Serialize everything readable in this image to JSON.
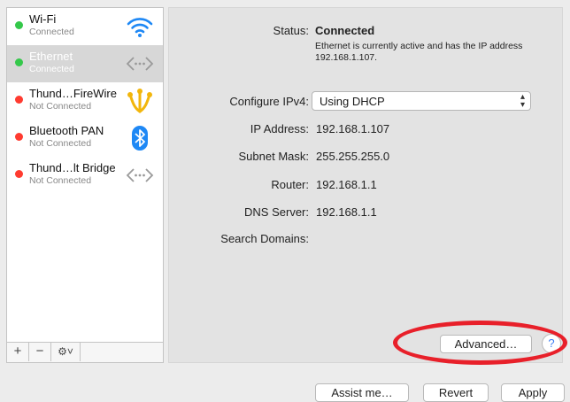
{
  "services": [
    {
      "name": "Wi-Fi",
      "status": "Connected",
      "status_color": "#34c84a",
      "icon": "wifi-icon",
      "selected": false
    },
    {
      "name": "Ethernet",
      "status": "Connected",
      "status_color": "#34c84a",
      "icon": "ethernet-icon",
      "selected": true
    },
    {
      "name": "Thund…FireWire",
      "status": "Not Connected",
      "status_color": "#ff3b30",
      "icon": "firewire-icon",
      "selected": false
    },
    {
      "name": "Bluetooth PAN",
      "status": "Not Connected",
      "status_color": "#ff3b30",
      "icon": "bluetooth-icon",
      "selected": false
    },
    {
      "name": "Thund…lt Bridge",
      "status": "Not Connected",
      "status_color": "#ff3b30",
      "icon": "ethernet-icon",
      "selected": false
    }
  ],
  "sidebar_controls": {
    "add": "+",
    "remove": "−",
    "gear": "⚙˅"
  },
  "details": {
    "status_label": "Status:",
    "status_value": "Connected",
    "status_note": "Ethernet is currently active and has the IP address 192.168.1.107.",
    "configure_label": "Configure IPv4:",
    "configure_value": "Using DHCP",
    "ip_label": "IP Address:",
    "ip_value": "192.168.1.107",
    "mask_label": "Subnet Mask:",
    "mask_value": "255.255.255.0",
    "router_label": "Router:",
    "router_value": "192.168.1.1",
    "dns_label": "DNS Server:",
    "dns_value": "192.168.1.1",
    "search_label": "Search Domains:",
    "search_value": ""
  },
  "buttons": {
    "advanced": "Advanced…",
    "help": "?",
    "assist": "Assist me…",
    "revert": "Revert",
    "apply": "Apply"
  },
  "colors": {
    "annotation": "#e8202a",
    "selected_row": "#d7d7d7"
  }
}
